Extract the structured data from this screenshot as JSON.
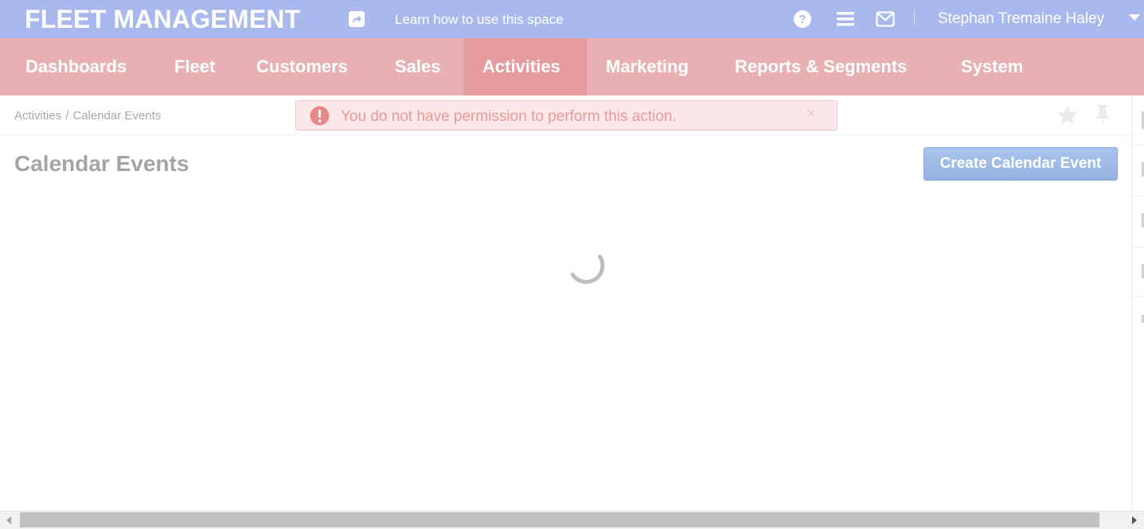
{
  "topbar": {
    "brand": "FLEET MANAGEMENT",
    "learn_link": "Learn how to use this space",
    "user_name": "Stephan Tremaine Haley",
    "icons": [
      "share-icon",
      "help-icon",
      "menu-icon",
      "mail-icon",
      "caret-down-icon"
    ]
  },
  "nav": {
    "items": [
      {
        "label": "Dashboards"
      },
      {
        "label": "Fleet"
      },
      {
        "label": "Customers"
      },
      {
        "label": "Sales"
      },
      {
        "label": "Activities",
        "active": true
      },
      {
        "label": "Marketing"
      },
      {
        "label": "Reports & Segments"
      },
      {
        "label": "System"
      }
    ]
  },
  "breadcrumb": {
    "parent": "Activities",
    "separator": "/",
    "current": "Calendar Events"
  },
  "alert": {
    "message": "You do not have permission to perform this action.",
    "close": "×",
    "icons": [
      "error-icon",
      "close-icon"
    ]
  },
  "page": {
    "title": "Calendar Events",
    "create_button": "Create Calendar Event",
    "loading": true
  },
  "colors": {
    "topbar": "#a9b9ee",
    "navbar": "#e8b0b2",
    "nav_active": "#e69b9d",
    "alert_bg": "#fde7e8",
    "alert_text": "#e59a9c",
    "button": "#9fbbe7"
  }
}
